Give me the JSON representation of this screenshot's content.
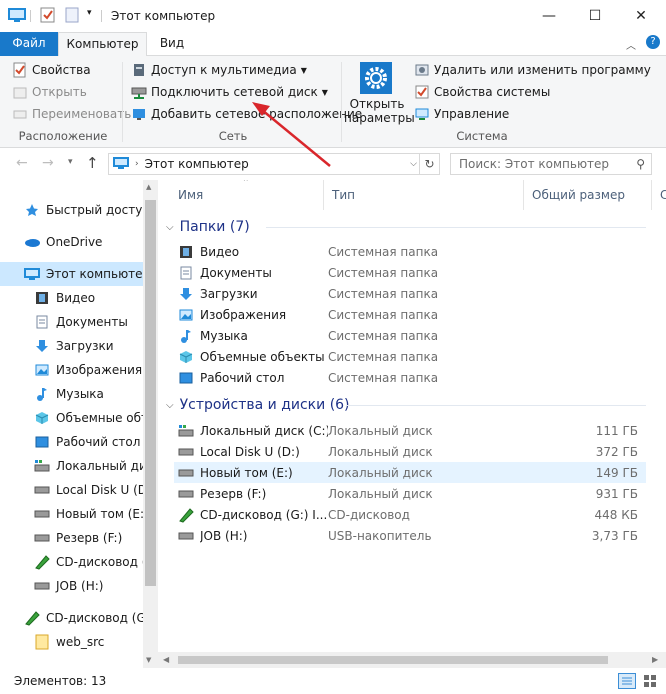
{
  "window": {
    "title": "Этот компьютер",
    "controls": [
      "—",
      "☐",
      "✕"
    ]
  },
  "ribbon_tabs": [
    "Файл",
    "Компьютер",
    "Вид"
  ],
  "ribbon": {
    "location_group": {
      "label": "Расположение",
      "items": [
        "Свойства",
        "Открыть",
        "Переименовать"
      ]
    },
    "network_group": {
      "label": "Сеть",
      "items": [
        "Доступ к мультимедиа",
        "Подключить сетевой диск",
        "Добавить сетевое расположение"
      ]
    },
    "open_settings": {
      "line1": "Открыть",
      "line2": "параметры"
    },
    "system_group": {
      "label": "Система",
      "items": [
        "Удалить или изменить программу",
        "Свойства системы",
        "Управление"
      ]
    }
  },
  "address": {
    "path": "Этот компьютер",
    "search_placeholder": "Поиск: Этот компьютер"
  },
  "sidebar": {
    "items": [
      {
        "label": "Быстрый доступ",
        "icon": "star-icon"
      },
      {
        "label": "OneDrive",
        "icon": "cloud-icon"
      },
      {
        "label": "Этот компьютер",
        "icon": "computer-icon",
        "selected": true
      },
      {
        "label": "Видео",
        "icon": "video-icon"
      },
      {
        "label": "Документы",
        "icon": "documents-icon"
      },
      {
        "label": "Загрузки",
        "icon": "downloads-icon"
      },
      {
        "label": "Изображения",
        "icon": "pictures-icon"
      },
      {
        "label": "Музыка",
        "icon": "music-icon"
      },
      {
        "label": "Объемные объекты",
        "icon": "3d-objects-icon"
      },
      {
        "label": "Рабочий стол",
        "icon": "desktop-icon"
      },
      {
        "label": "Локальный диск (C:)",
        "icon": "system-drive-icon"
      },
      {
        "label": "Local Disk U (D:)",
        "icon": "drive-icon"
      },
      {
        "label": "Новый том (E:)",
        "icon": "drive-icon"
      },
      {
        "label": "Резерв (F:)",
        "icon": "drive-icon"
      },
      {
        "label": "CD-дисковод (G:)",
        "icon": "cd-drive-icon"
      },
      {
        "label": "JOB (H:)",
        "icon": "usb-drive-icon"
      },
      {
        "label": "CD-дисковод (G:)",
        "icon": "cd-drive-icon"
      },
      {
        "label": "web_src",
        "icon": "folder-icon"
      }
    ]
  },
  "columns": [
    "Имя",
    "Тип",
    "Общий размер",
    "С"
  ],
  "groups": [
    {
      "title": "Папки (7)",
      "rows": [
        {
          "name": "Видео",
          "type": "Системная папка",
          "size": "",
          "icon": "video-icon"
        },
        {
          "name": "Документы",
          "type": "Системная папка",
          "size": "",
          "icon": "documents-icon"
        },
        {
          "name": "Загрузки",
          "type": "Системная папка",
          "size": "",
          "icon": "downloads-icon"
        },
        {
          "name": "Изображения",
          "type": "Системная папка",
          "size": "",
          "icon": "pictures-icon"
        },
        {
          "name": "Музыка",
          "type": "Системная папка",
          "size": "",
          "icon": "music-icon"
        },
        {
          "name": "Объемные объекты",
          "type": "Системная папка",
          "size": "",
          "icon": "3d-objects-icon"
        },
        {
          "name": "Рабочий стол",
          "type": "Системная папка",
          "size": "",
          "icon": "desktop-icon"
        }
      ]
    },
    {
      "title": "Устройства и диски (6)",
      "rows": [
        {
          "name": "Локальный диск (C:)",
          "type": "Локальный диск",
          "size": "111 ГБ",
          "icon": "system-drive-icon"
        },
        {
          "name": "Local Disk U (D:)",
          "type": "Локальный диск",
          "size": "372 ГБ",
          "icon": "drive-icon"
        },
        {
          "name": "Новый том (E:)",
          "type": "Локальный диск",
          "size": "149 ГБ",
          "icon": "drive-icon",
          "highlight": true
        },
        {
          "name": "Резерв (F:)",
          "type": "Локальный диск",
          "size": "931 ГБ",
          "icon": "drive-icon"
        },
        {
          "name": "CD-дисковод (G:) I...",
          "type": "CD-дисковод",
          "size": "448 КБ",
          "icon": "cd-drive-icon"
        },
        {
          "name": "JOB (H:)",
          "type": "USB-накопитель",
          "size": "3,73 ГБ",
          "icon": "usb-drive-icon"
        }
      ]
    }
  ],
  "status": {
    "items_count": "Элементов: 13"
  },
  "colors": {
    "accent": "#1979ca",
    "selected": "#cce8ff",
    "group_title": "#1e3287",
    "annotation_arrow": "#d9262b"
  }
}
